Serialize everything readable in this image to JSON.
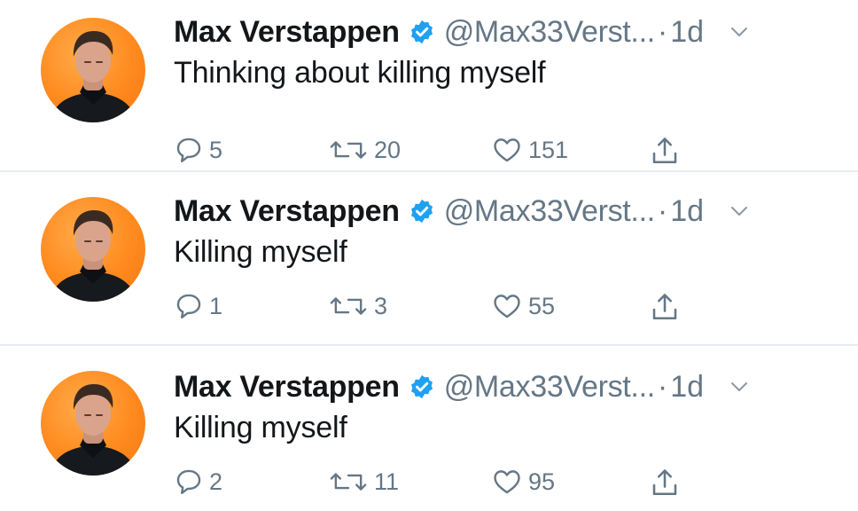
{
  "colors": {
    "verified": "#1da1f2",
    "secondary_text": "#657786",
    "avatar_bg": "#ff8a1e"
  },
  "tweets": [
    {
      "author": "Max Verstappen",
      "handle": "@Max33Verst...",
      "separator": "·",
      "time": "1d",
      "text": "Thinking about killing myself",
      "replies": "5",
      "retweets": "20",
      "likes": "151"
    },
    {
      "author": "Max Verstappen",
      "handle": "@Max33Verst...",
      "separator": "·",
      "time": "1d",
      "text": "Killing myself",
      "replies": "1",
      "retweets": "3",
      "likes": "55"
    },
    {
      "author": "Max Verstappen",
      "handle": "@Max33Verst...",
      "separator": "·",
      "time": "1d",
      "text": "Killing myself",
      "replies": "2",
      "retweets": "11",
      "likes": "95"
    }
  ],
  "icons": {
    "avatar": "person-portrait",
    "verified": "verified-badge-icon",
    "caret": "chevron-down-icon",
    "reply": "reply-icon",
    "retweet": "retweet-icon",
    "like": "heart-icon",
    "share": "share-icon"
  }
}
